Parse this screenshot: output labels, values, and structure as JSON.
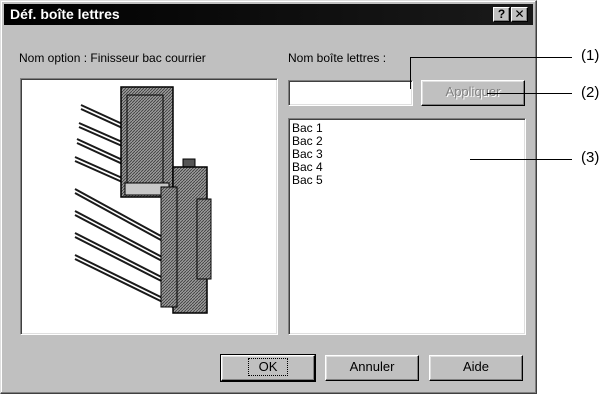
{
  "window": {
    "title": "Déf. boîte lettres",
    "help_label": "?",
    "close_label": "✕"
  },
  "option_label": "Nom option : Finisseur bac courrier",
  "mailbox_name_label": "Nom boîte lettres :",
  "mailbox_name_input": {
    "value": "",
    "placeholder": ""
  },
  "apply_button": "Appliquer",
  "mailboxes": [
    "Bac 1",
    "Bac 2",
    "Bac 3",
    "Bac 4",
    "Bac 5"
  ],
  "buttons": {
    "ok": "OK",
    "cancel": "Annuler",
    "help": "Aide"
  },
  "callouts": [
    "(1)",
    "(2)",
    "(3)"
  ]
}
